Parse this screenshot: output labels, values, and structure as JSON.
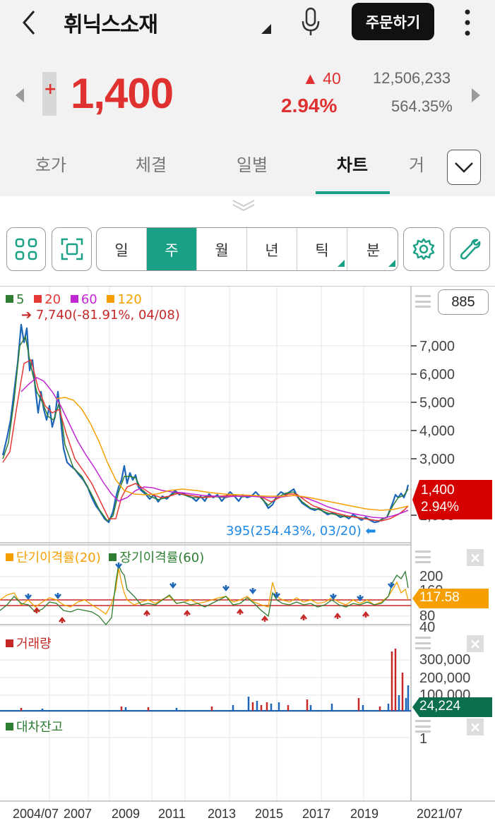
{
  "header": {
    "back": "<",
    "title": "휘닉스소재",
    "order_label": "주문하기"
  },
  "quote": {
    "sign": "+",
    "price": "1,400",
    "change": "▲ 40",
    "change_pct": "2.94%",
    "volume": "12,506,233",
    "volume_ratio": "564.35%"
  },
  "tabs": [
    {
      "label": "호가"
    },
    {
      "label": "체결"
    },
    {
      "label": "일별"
    },
    {
      "label": "차트"
    },
    {
      "label": "거"
    }
  ],
  "toolbar": {
    "periods": [
      "일",
      "주",
      "월",
      "년",
      "틱",
      "분"
    ],
    "active_period": "주"
  },
  "price_panel": {
    "ma_labels": [
      "5",
      "20",
      "60",
      "120"
    ],
    "ma_colors": [
      "#2e7d32",
      "#e53935",
      "#c026d3",
      "#f5a000"
    ],
    "max_annotation": "7,740(-81.91%, 04/08)",
    "min_annotation": "395(254.43%, 03/20)",
    "count_box": "885",
    "y_ticks": [
      "7,000",
      "6,000",
      "5,000",
      "4,000",
      "3,000",
      "1,000"
    ],
    "current_price": "1,400",
    "current_pct": "2.94%"
  },
  "disparity_panel": {
    "label_short": "단기이격률(20)",
    "label_long": "장기이격률(60)",
    "y_ticks": [
      "200",
      "160",
      "80",
      "40"
    ],
    "current": "117.58"
  },
  "volume_panel": {
    "label": "거래량",
    "y_ticks": [
      "300,000",
      "200,000",
      "100,000"
    ],
    "current": "24,224"
  },
  "loan_panel": {
    "label": "대차잔고",
    "y_tick": "1"
  },
  "x_axis": [
    "2004/07",
    "2007",
    "2009",
    "2011",
    "2013",
    "2015",
    "2017",
    "2019",
    "2021/07"
  ],
  "chart_data": {
    "type": "line",
    "series": [
      {
        "name": "5",
        "color": "#2e7d32"
      },
      {
        "name": "20",
        "color": "#e53935"
      },
      {
        "name": "60",
        "color": "#c026d3"
      },
      {
        "name": "120",
        "color": "#f5a000"
      }
    ],
    "x": [
      "2004/07",
      "2007",
      "2009",
      "2011",
      "2013",
      "2015",
      "2017",
      "2019",
      "2021/07"
    ],
    "max_point": {
      "value": 7740,
      "label": "7,740(-81.91%, 04/08)"
    },
    "min_point": {
      "value": 395,
      "label": "395(254.43%, 03/20)"
    },
    "last_value": 1400
  }
}
